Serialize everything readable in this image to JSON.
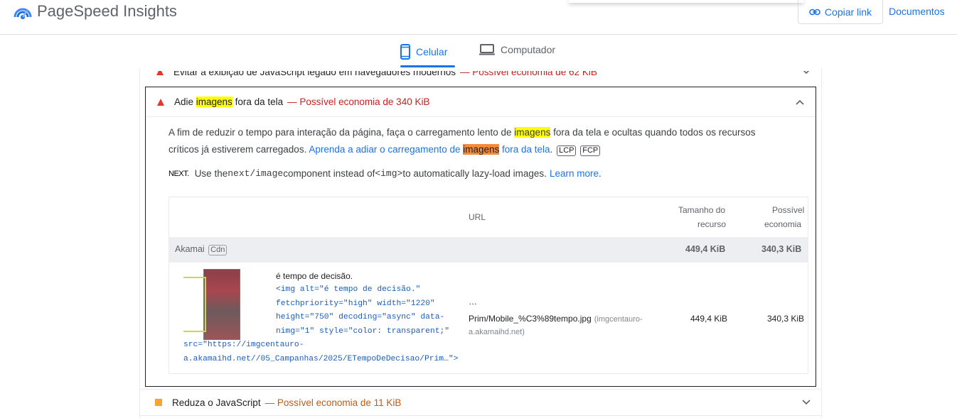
{
  "header": {
    "app_title": "PageSpeed Insights",
    "copy_link_label": "Copiar link",
    "docs_label": "Documentos"
  },
  "tabs": [
    {
      "label": "Celular",
      "active": true
    },
    {
      "label": "Computador",
      "active": false
    }
  ],
  "audits": {
    "top": {
      "title": "Evitar a exibição de JavaScript legado em navegadores modernos",
      "saving": "— Possível economia de 62 KiB",
      "severity": "fail"
    },
    "open": {
      "title_pre": "Adie ",
      "title_hl": "imagens",
      "title_post": " fora da tela",
      "saving": "— Possível economia de 340 KiB",
      "desc_1": "A fim de reduzir o tempo para interação da página, faça o carregamento lento de ",
      "desc_hl": "imagens",
      "desc_2": " fora da tela e ocultas quando todos os recursos",
      "desc_3": "críticos já estiverem carregados. ",
      "link_pre": "Aprenda a adiar o carregamento de ",
      "link_hl": "imagens",
      "link_post": " fora da tela",
      "period": ".",
      "badges": [
        "LCP",
        "FCP"
      ],
      "stack": {
        "logo": "NEXT.",
        "t1": "Use the ",
        "code1": "next/image",
        "t2": " component instead of ",
        "code2": "<img>",
        "t3": " to automatically lazy-load images.",
        "link": "Learn more",
        "period": "."
      },
      "table": {
        "headers": {
          "url": "URL",
          "size_1": "Tamanho do",
          "size_2": "recurso",
          "saving_1": "Possível",
          "saving_2": "economia"
        },
        "group": {
          "name": "Akamai",
          "badge": "Cdn",
          "size": "449,4 KiB",
          "saving": "340,3 KiB"
        },
        "item": {
          "alt_text": "é tempo de decisão.",
          "code_lines": [
            "<img alt=\"é tempo de decisão.\"",
            "fetchpriority=\"high\" width=\"1220\"",
            "height=\"750\" decoding=\"async\" data-",
            "nimg=\"1\" style=\"color: transparent;\""
          ],
          "code_tail": [
            "src=\"https://imgcentauro-",
            "a.akamaihd.net//05_Campanhas/2025/ETempoDeDecisao/Prim…\">"
          ],
          "url_ellipsis": "…",
          "url_path": "Prim/Mobile_%C3%89tempo.jpg",
          "url_host_1": "(imgcentauro-",
          "url_host_2": "a.akamaihd.net)",
          "size": "449,4 KiB",
          "saving": "340,3 KiB"
        }
      }
    },
    "bottom": {
      "title": "Reduza o JavaScript",
      "saving": "— Possível economia de 11 KiB",
      "severity": "average"
    }
  },
  "colors": {
    "accent": "#1a73e8",
    "fail": "#e8352b",
    "average": "#fba42b",
    "highlight": "#ffff00",
    "highlight_active": "#f28b3b"
  }
}
